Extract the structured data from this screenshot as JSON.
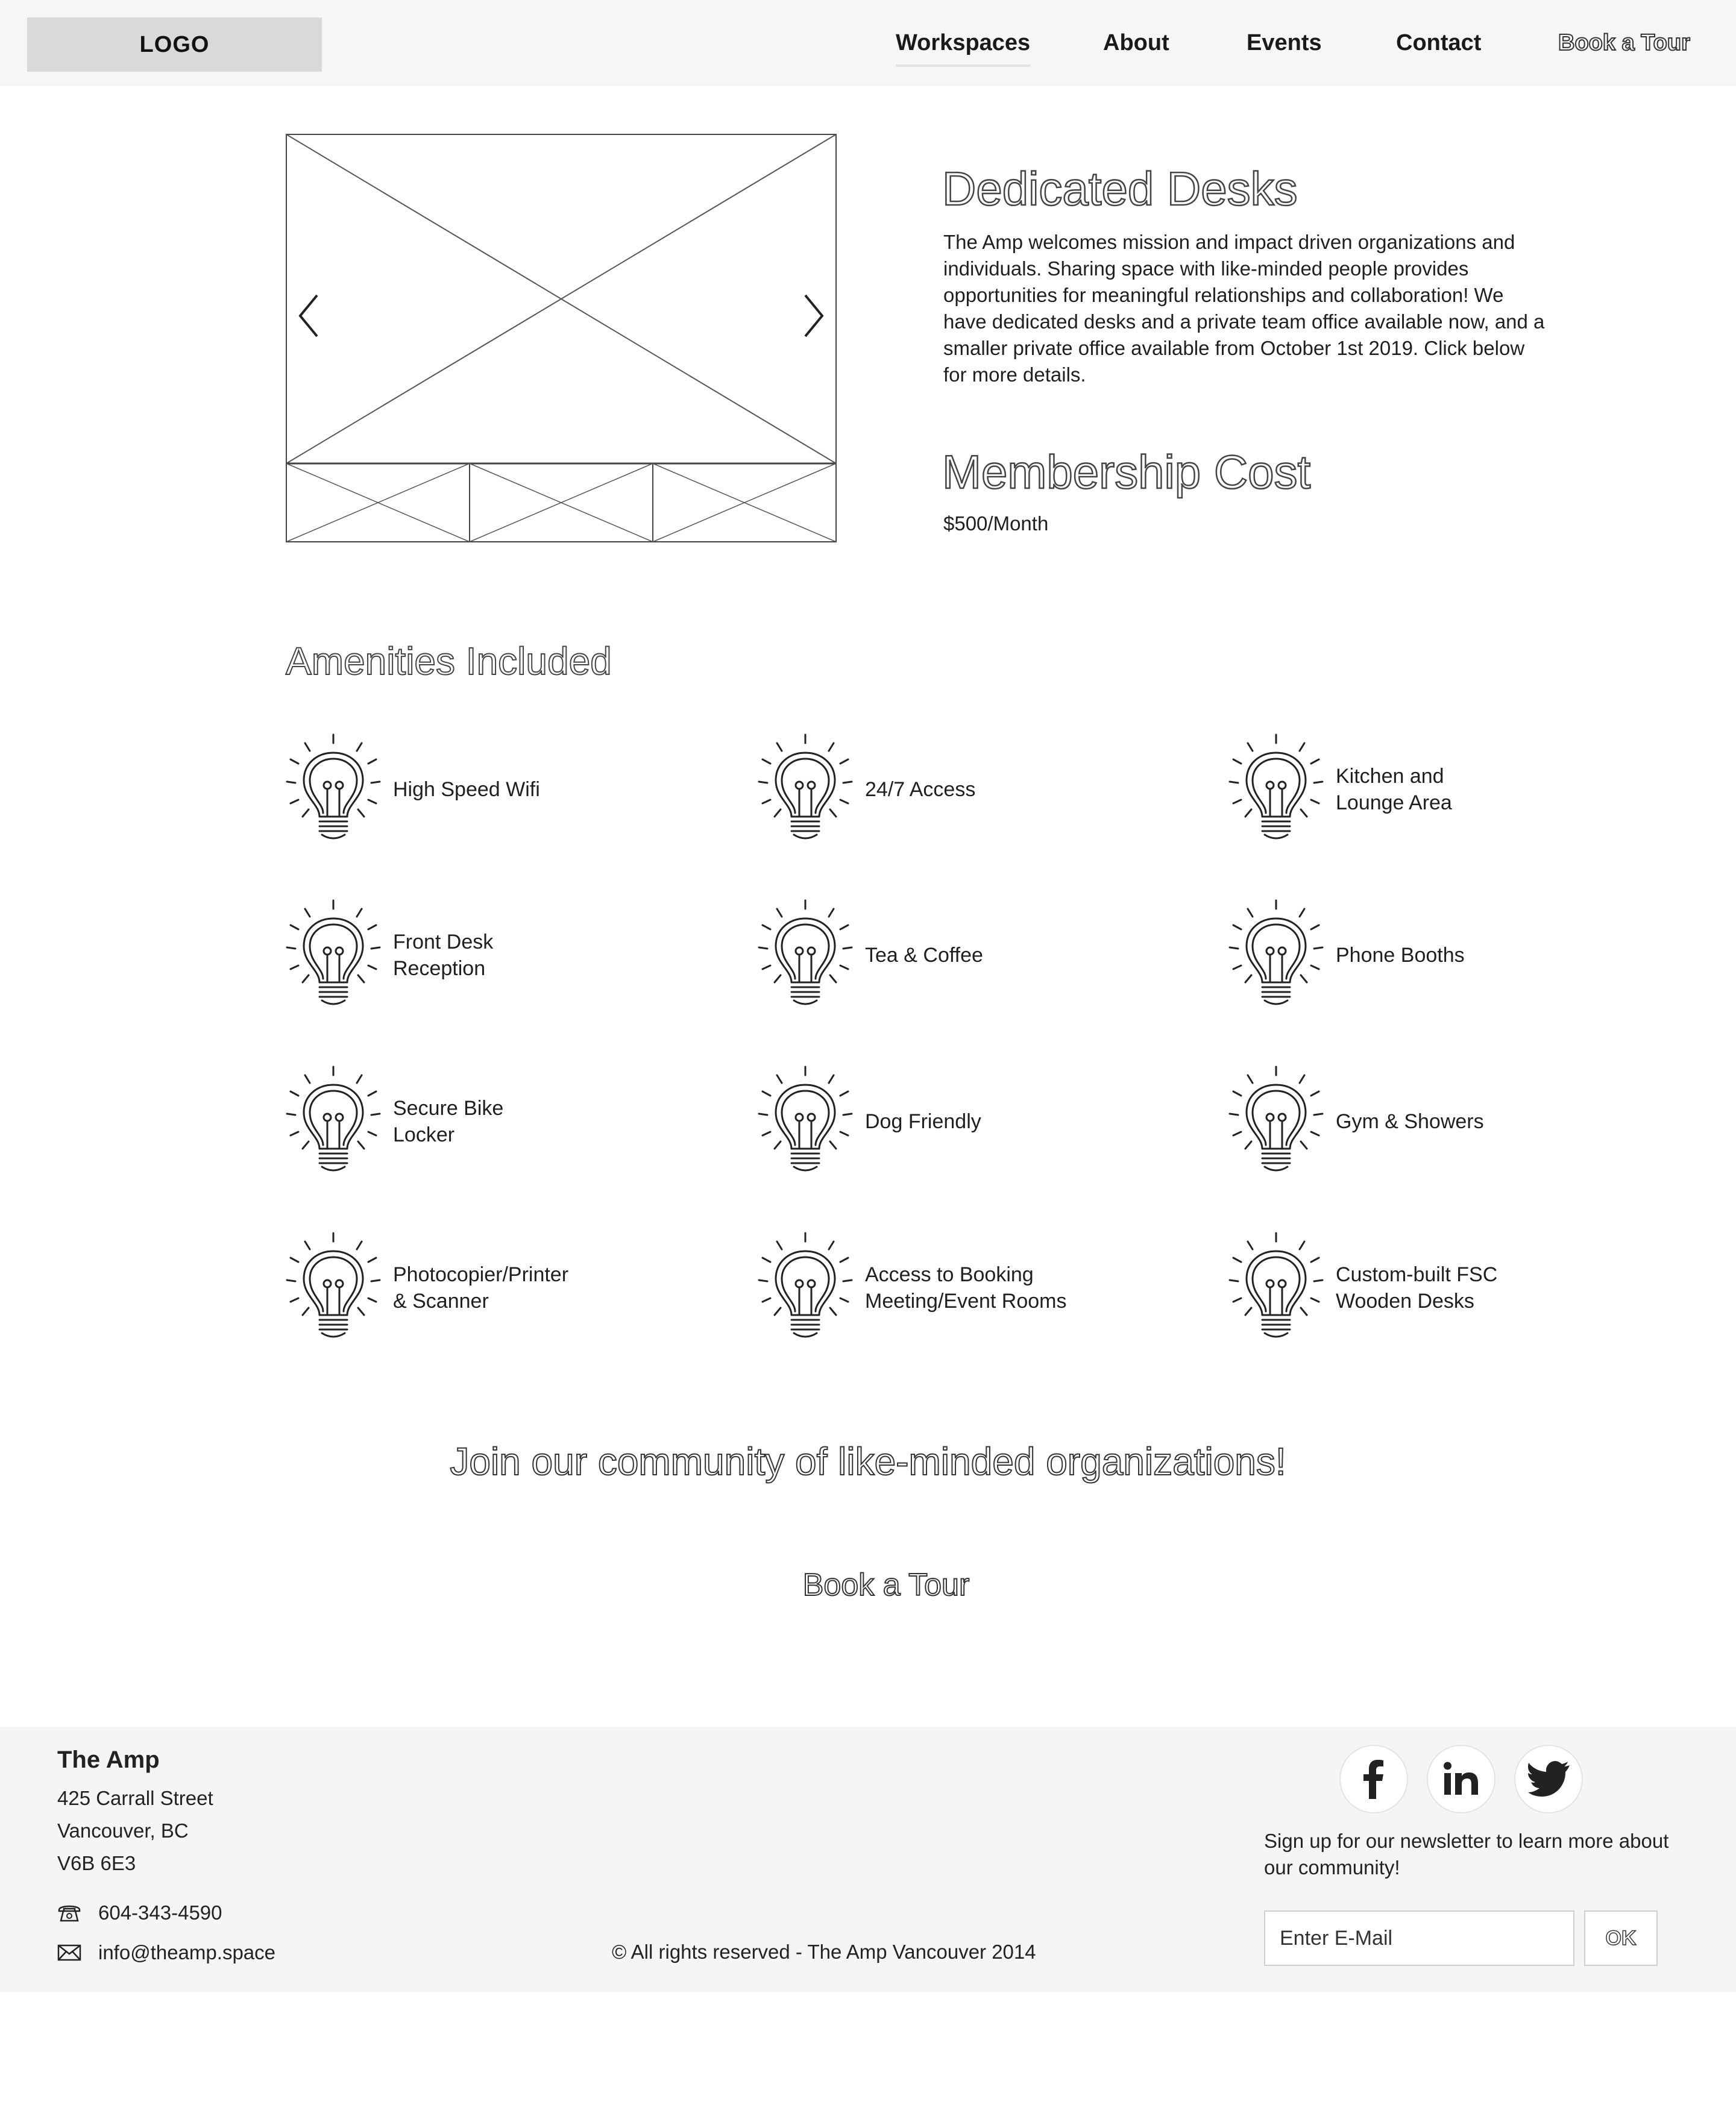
{
  "header": {
    "logo": "LOGO",
    "nav": [
      "Workspaces",
      "About",
      "Events",
      "Contact",
      "Book a Tour"
    ],
    "active_nav": "Workspaces"
  },
  "hero": {
    "title": "Dedicated Desks",
    "description": "The Amp welcomes mission and impact driven organizations and individuals. Sharing space with like-minded people provides opportunities for meaningful relationships and collaboration! We have dedicated desks and a private team office available now, and a smaller private office available from October 1st 2019. Click below for more details.",
    "cost_title": "Membership Cost",
    "cost_value": "$500/Month"
  },
  "amenities": {
    "title": "Amenities Included",
    "icon": "lightbulb-icon",
    "items": [
      "High Speed Wifi",
      "24/7 Access",
      "Kitchen and\nLounge Area",
      "Front Desk\nReception",
      "Tea & Coffee",
      "Phone Booths",
      "Secure Bike\nLocker",
      "Dog Friendly",
      "Gym & Showers",
      "Photocopier/Printer\n& Scanner",
      "Access to Booking\nMeeting/Event Rooms",
      "Custom-built FSC\nWooden Desks"
    ]
  },
  "cta": {
    "heading": "Join our community of like-minded organizations!",
    "button": "Book a Tour"
  },
  "footer": {
    "name": "The Amp",
    "address": [
      "425 Carrall Street",
      "Vancouver, BC",
      "V6B 6E3"
    ],
    "phone": "604-343-4590",
    "email": "info@theamp.space",
    "copyright": "© All rights reserved - The Amp Vancouver 2014",
    "social": [
      "facebook-icon",
      "linkedin-icon",
      "twitter-icon"
    ],
    "newsletter_text": "Sign up for our newsletter to learn more about our community!",
    "email_placeholder": "Enter E-Mail",
    "ok_label": "OK"
  },
  "colors": {
    "header_bg": "#f6f6f6",
    "logo_bg": "#d9d9d9",
    "footer_bg": "#f5f5f5",
    "text": "#222222"
  }
}
